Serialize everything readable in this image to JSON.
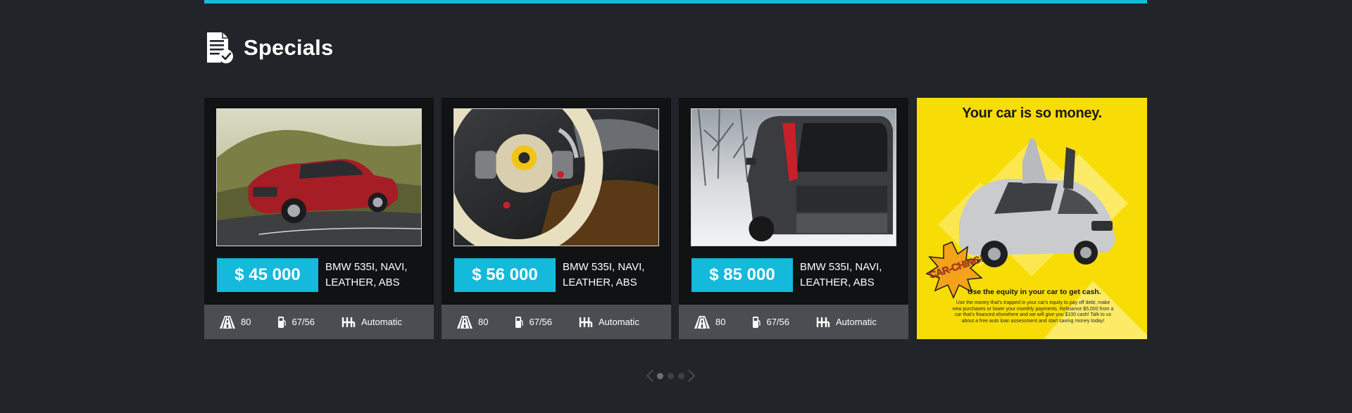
{
  "section": {
    "title": "Specials",
    "title_icon": "document-check-icon"
  },
  "colors": {
    "accent": "#14b9dc",
    "background": "#212428",
    "card": "#111214",
    "spec_bar": "#4a4d51",
    "ad_yellow": "#f7dc05"
  },
  "cards": [
    {
      "photo": "red-sedan-photo",
      "price": "$ 45 000",
      "model": "BMW 535I, NAVI, LEATHER, ABS",
      "mileage": "80",
      "fuel": "67/56",
      "transmission": "Automatic"
    },
    {
      "photo": "steering-wheel-photo",
      "price": "$ 56 000",
      "model": "BMW 535I, NAVI, LEATHER, ABS",
      "mileage": "80",
      "fuel": "67/56",
      "transmission": "Automatic"
    },
    {
      "photo": "suv-in-snow-photo",
      "price": "$ 85 000",
      "model": "BMW 535I, NAVI, LEATHER, ABS",
      "mileage": "80",
      "fuel": "67/56",
      "transmission": "Automatic"
    }
  ],
  "ad": {
    "title": "Your car is so money.",
    "burst": "CAR-CHING!",
    "subtitle": "Use the equity in your car to get cash.",
    "body": "Use the money that's trapped in your car's equity to pay off debt, make new purchases or lower your monthly payments. Refinance $5,000 from a car that's financed elsewhere and we will give you $100 cash! Talk to us about a free auto loan assessment and start saving money today!"
  },
  "pager": {
    "pages": 3,
    "active": 1,
    "prev_icon": "chevron-left-icon",
    "next_icon": "chevron-right-icon"
  }
}
